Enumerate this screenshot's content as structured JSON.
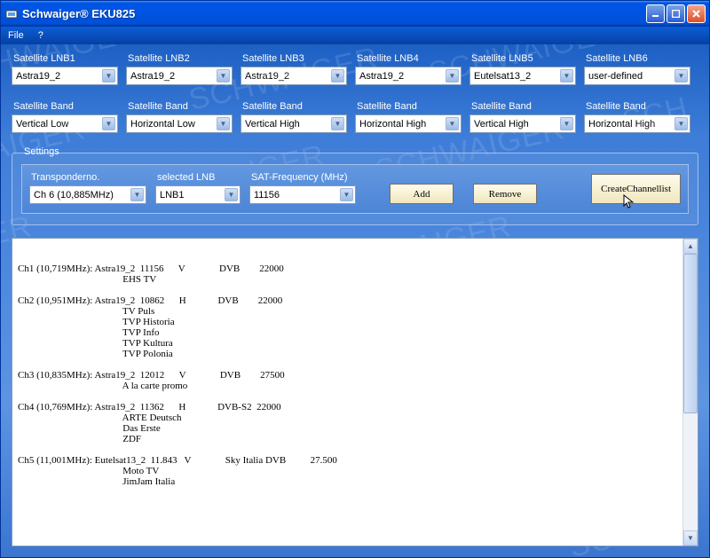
{
  "window": {
    "title": "Schwaiger® EKU825"
  },
  "menu": {
    "file": "File",
    "help": "?"
  },
  "lnb_label": "Satellite LNB",
  "band_label": "Satellite Band",
  "lnb": [
    {
      "label": "Satellite LNB1",
      "value": "Astra19_2"
    },
    {
      "label": "Satellite LNB2",
      "value": "Astra19_2"
    },
    {
      "label": "Satellite LNB3",
      "value": "Astra19_2"
    },
    {
      "label": "Satellite LNB4",
      "value": "Astra19_2"
    },
    {
      "label": "Satellite LNB5",
      "value": "Eutelsat13_2"
    },
    {
      "label": "Satellite LNB6",
      "value": "user-defined"
    }
  ],
  "band": [
    {
      "label": "Satellite Band",
      "value": "Vertical Low"
    },
    {
      "label": "Satellite Band",
      "value": "Horizontal Low"
    },
    {
      "label": "Satellite Band",
      "value": "Vertical High"
    },
    {
      "label": "Satellite Band",
      "value": "Horizontal High"
    },
    {
      "label": "Satellite Band",
      "value": "Vertical High"
    },
    {
      "label": "Satellite Band",
      "value": "Horizontal High"
    }
  ],
  "settings": {
    "legend": "Settings",
    "transponder_label": "Transponderno.",
    "transponder_value": "Ch 6 (10,885MHz)",
    "selected_lnb_label": "selected LNB",
    "selected_lnb_value": "LNB1",
    "sat_freq_label": "SAT-Frequency (MHz)",
    "sat_freq_value": "11156",
    "add_label": "Add",
    "remove_label": "Remove",
    "create_label_line1": "Create",
    "create_label_line2": "Channel",
    "create_label_line3": "list"
  },
  "channels_text": "Ch1 (10,719MHz): Astra19_2  11156      V              DVB        22000\n                                           EHS TV\n\nCh2 (10,951MHz): Astra19_2  10862      H             DVB        22000\n                                           TV Puls\n                                           TVP Historia\n                                           TVP Info\n                                           TVP Kultura\n                                           TVP Polonia\n\nCh3 (10,835MHz): Astra19_2  12012      V              DVB        27500\n                                           A la carte promo\n\nCh4 (10,769MHz): Astra19_2  11362      H             DVB-S2  22000\n                                           ARTE Deutsch\n                                           Das Erste\n                                           ZDF\n\nCh5 (11,001MHz): Eutelsat13_2  11.843   V              Sky Italia DVB          27.500\n                                           Moto TV\n                                           JimJam Italia"
}
